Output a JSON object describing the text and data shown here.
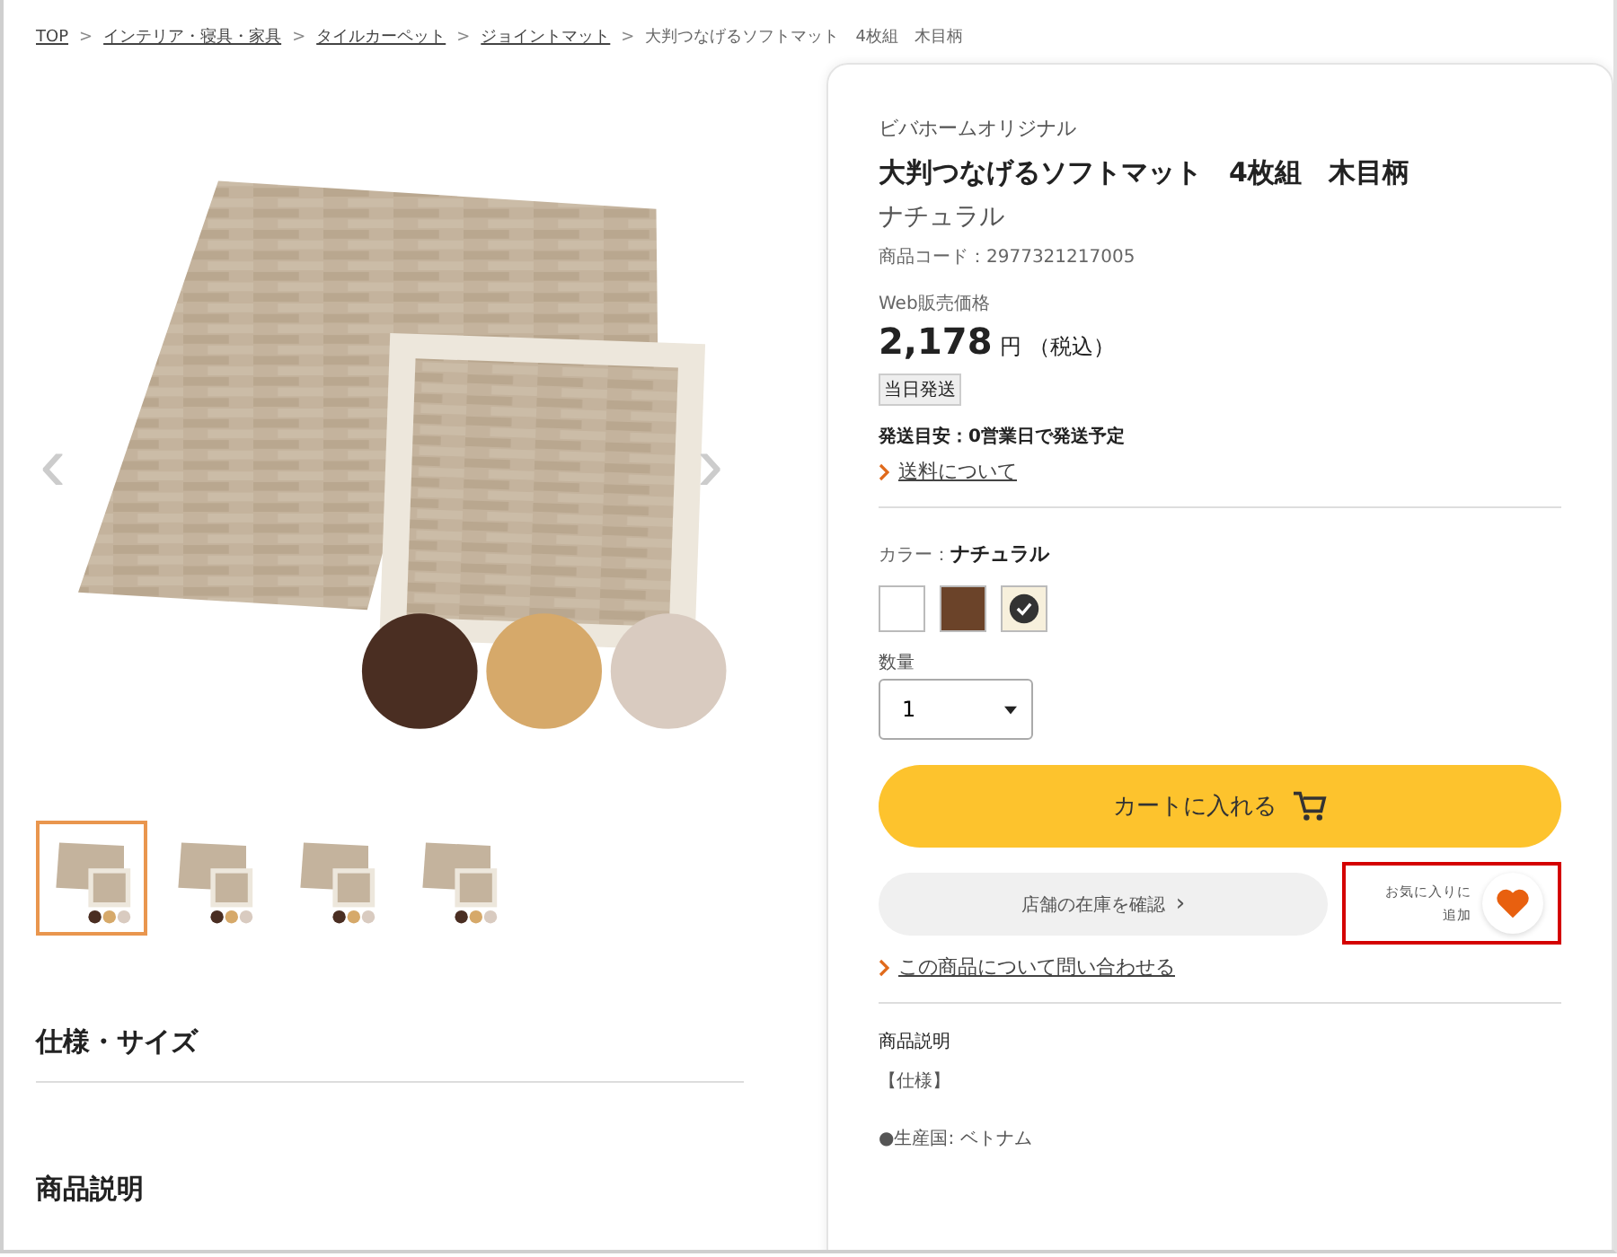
{
  "breadcrumb": [
    {
      "label": "TOP",
      "link": true
    },
    {
      "label": "インテリア・寝具・家具",
      "link": true
    },
    {
      "label": "タイルカーペット",
      "link": true
    },
    {
      "label": "ジョイントマット",
      "link": true
    },
    {
      "label": "大判つなげるソフトマット　4枚組　木目柄",
      "link": false
    }
  ],
  "breadcrumb_separator": ">",
  "gallery": {
    "prev": "‹",
    "next": "›",
    "thumbnails": [
      {
        "selected": true
      },
      {
        "selected": false
      },
      {
        "selected": false
      },
      {
        "selected": false
      }
    ]
  },
  "spec_heading": "仕様・サイズ",
  "description_heading": "商品説明",
  "product": {
    "brand": "ビバホームオリジナル",
    "name": "大判つなげるソフトマット　4枚組　木目柄",
    "variant": "ナチュラル",
    "code": "商品コード：2977321217005",
    "price_label": "Web販売価格",
    "price": "2,178",
    "currency": "円",
    "tax": "（税込）",
    "badge": "当日発送",
    "shipping": "発送目安：0営業日で発送予定",
    "shipping_link": "送料について",
    "color_label": "カラー：",
    "color_value": "ナチュラル",
    "colors": [
      {
        "color": "#ffffff",
        "selected": false
      },
      {
        "color": "#6b4329",
        "selected": false
      },
      {
        "color": "#f7f0dc",
        "selected": true
      }
    ],
    "quantity_label": "数量",
    "quantity": "1",
    "cart_button": "カートに入れる",
    "stock_button": "店舗の在庫を確認",
    "stock_chevron": "›",
    "favorite": {
      "label_1": "お気に入りに",
      "label_2": "追加",
      "highlighted": true
    },
    "inquiry_link": "この商品について問い合わせる",
    "description_heading": "商品説明",
    "description_lines": [
      "【仕様】",
      "●生産国: ベトナム"
    ]
  }
}
